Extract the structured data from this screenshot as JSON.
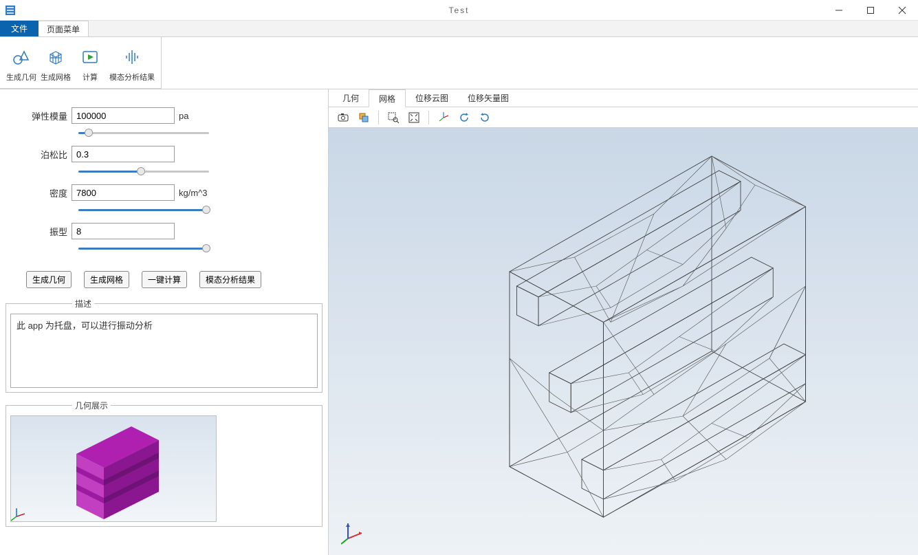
{
  "window": {
    "title": "Test"
  },
  "menu": {
    "file": "文件",
    "page_menu": "页面菜单"
  },
  "ribbon": {
    "gen_geom": "生成几何",
    "gen_mesh": "生成网格",
    "compute": "计算",
    "modal_result": "模态分析结果"
  },
  "form": {
    "elastic_modulus": {
      "label": "弹性模量",
      "value": "100000",
      "unit": "pa",
      "slider_pct": 8
    },
    "poisson": {
      "label": "泊松比",
      "value": "0.3",
      "unit": "",
      "slider_pct": 48
    },
    "density": {
      "label": "密度",
      "value": "7800",
      "unit": "kg/m^3",
      "slider_pct": 98
    },
    "mode": {
      "label": "振型",
      "value": "8",
      "unit": "",
      "slider_pct": 98
    }
  },
  "buttons": {
    "gen_geom": "生成几何",
    "gen_mesh": "生成网格",
    "compute": "一键计算",
    "modal_result": "模态分析结果"
  },
  "desc": {
    "title": "描述",
    "text": "此 app 为托盘，可以进行振动分析"
  },
  "preview": {
    "title": "几何展示"
  },
  "view_tabs": {
    "geom": "几何",
    "mesh": "网格",
    "disp_cloud": "位移云图",
    "disp_vector": "位移矢量图",
    "active_index": 1
  },
  "view_toolbar": {
    "camera": "camera-icon",
    "scene": "scene-icon",
    "select": "zoom-select-icon",
    "extent": "zoom-extent-icon",
    "axes": "axes-icon",
    "rotate_ccw": "rotate-ccw-icon",
    "rotate_cw": "rotate-cw-icon"
  },
  "colors": {
    "accent": "#0a63ac",
    "slider_fill": "#3a7ec1",
    "preview_solid": "#a818a8"
  }
}
